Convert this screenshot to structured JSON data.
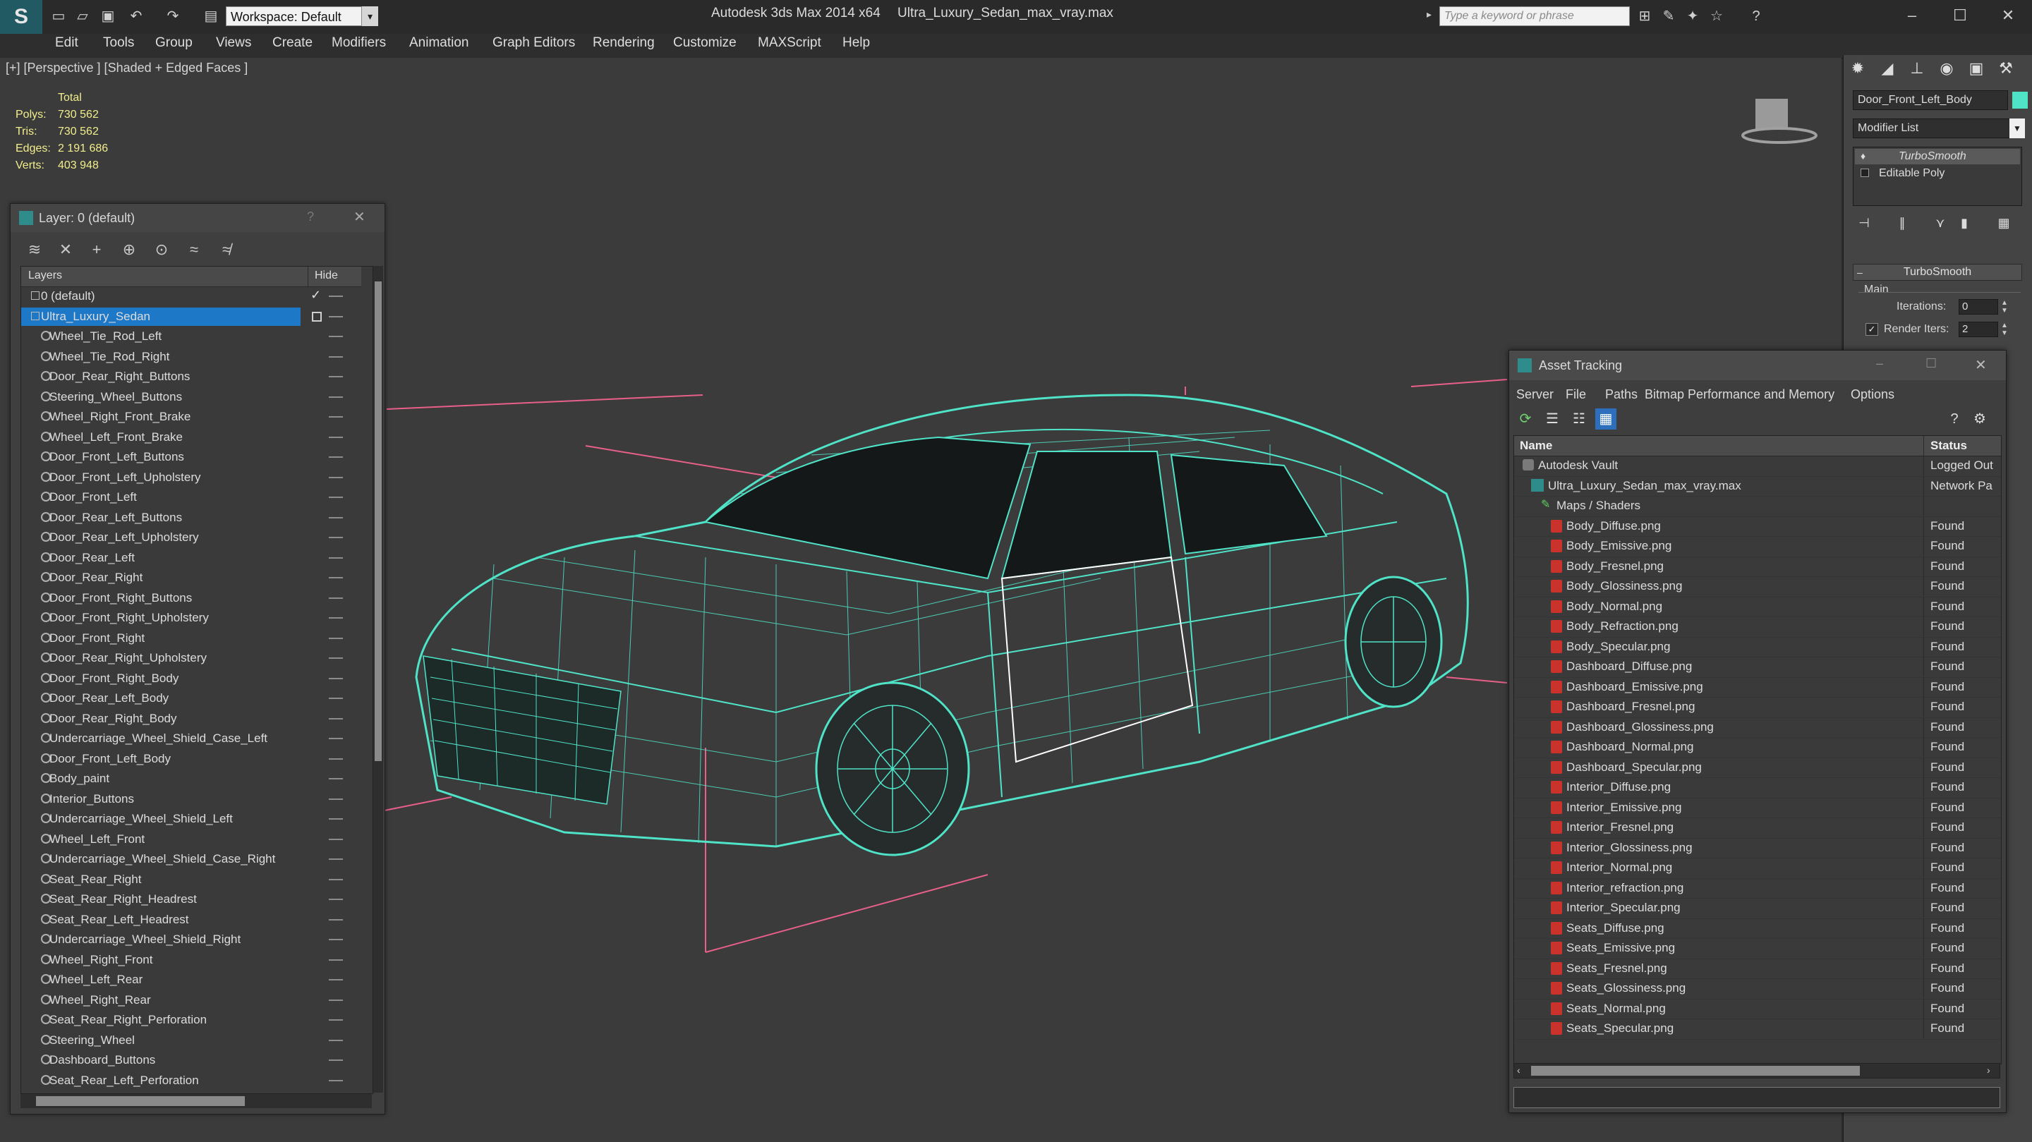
{
  "titlebar": {
    "workspace": "Workspace: Default",
    "app_title": "Autodesk 3ds Max  2014 x64",
    "file_title": "Ultra_Luxury_Sedan_max_vray.max",
    "search_placeholder": "Type a keyword or phrase"
  },
  "menu": [
    "Edit",
    "Tools",
    "Group",
    "Views",
    "Create",
    "Modifiers",
    "Animation",
    "Graph Editors",
    "Rendering",
    "Customize",
    "MAXScript",
    "Help"
  ],
  "viewport": {
    "label": "[+] [Perspective ] [Shaded + Edged Faces ]",
    "stats_header": "Total",
    "stats": [
      {
        "label": "Polys:",
        "value": "730 562"
      },
      {
        "label": "Tris:",
        "value": "730 562"
      },
      {
        "label": "Edges:",
        "value": "2 191 686"
      },
      {
        "label": "Verts:",
        "value": "403 948"
      }
    ],
    "wire_color": "#4fe3c8"
  },
  "layer_panel": {
    "title": "Layer: 0 (default)",
    "col_layers": "Layers",
    "col_hide": "Hide",
    "rows": [
      "0 (default)",
      "Ultra_Luxury_Sedan",
      "Wheel_Tie_Rod_Left",
      "Wheel_Tie_Rod_Right",
      "Door_Rear_Right_Buttons",
      "Steering_Wheel_Buttons",
      "Wheel_Right_Front_Brake",
      "Wheel_Left_Front_Brake",
      "Door_Front_Left_Buttons",
      "Door_Front_Left_Upholstery",
      "Door_Front_Left",
      "Door_Rear_Left_Buttons",
      "Door_Rear_Left_Upholstery",
      "Door_Rear_Left",
      "Door_Rear_Right",
      "Door_Front_Right_Buttons",
      "Door_Front_Right_Upholstery",
      "Door_Front_Right",
      "Door_Rear_Right_Upholstery",
      "Door_Front_Right_Body",
      "Door_Rear_Left_Body",
      "Door_Rear_Right_Body",
      "Undercarriage_Wheel_Shield_Case_Left",
      "Door_Front_Left_Body",
      "Body_paint",
      "Interior_Buttons",
      "Undercarriage_Wheel_Shield_Left",
      "Wheel_Left_Front",
      "Undercarriage_Wheel_Shield_Case_Right",
      "Seat_Rear_Right",
      "Seat_Rear_Right_Headrest",
      "Seat_Rear_Left_Headrest",
      "Undercarriage_Wheel_Shield_Right",
      "Wheel_Right_Front",
      "Wheel_Left_Rear",
      "Wheel_Right_Rear",
      "Seat_Rear_Right_Perforation",
      "Steering_Wheel",
      "Dashboard_Buttons",
      "Seat_Rear_Left_Perforation"
    ]
  },
  "command_panel": {
    "object_name": "Door_Front_Left_Body",
    "modifier_list": "Modifier List",
    "stack": [
      "TurboSmooth",
      "Editable Poly"
    ],
    "rollout": "TurboSmooth",
    "group": "Main",
    "iterations_label": "Iterations:",
    "iterations_value": "0",
    "render_iters_label": "Render Iters:",
    "render_iters_value": "2"
  },
  "asset_tracking": {
    "title": "Asset Tracking",
    "menu": [
      "Server",
      "File",
      "Paths",
      "Bitmap Performance and Memory",
      "Options"
    ],
    "col_name": "Name",
    "col_status": "Status",
    "rows": [
      {
        "name": "Autodesk Vault",
        "status": "Logged Out"
      },
      {
        "name": "Ultra_Luxury_Sedan_max_vray.max",
        "status": "Network Pa"
      },
      {
        "name": "Maps / Shaders",
        "status": ""
      },
      {
        "name": "Body_Diffuse.png",
        "status": "Found"
      },
      {
        "name": "Body_Emissive.png",
        "status": "Found"
      },
      {
        "name": "Body_Fresnel.png",
        "status": "Found"
      },
      {
        "name": "Body_Glossiness.png",
        "status": "Found"
      },
      {
        "name": "Body_Normal.png",
        "status": "Found"
      },
      {
        "name": "Body_Refraction.png",
        "status": "Found"
      },
      {
        "name": "Body_Specular.png",
        "status": "Found"
      },
      {
        "name": "Dashboard_Diffuse.png",
        "status": "Found"
      },
      {
        "name": "Dashboard_Emissive.png",
        "status": "Found"
      },
      {
        "name": "Dashboard_Fresnel.png",
        "status": "Found"
      },
      {
        "name": "Dashboard_Glossiness.png",
        "status": "Found"
      },
      {
        "name": "Dashboard_Normal.png",
        "status": "Found"
      },
      {
        "name": "Dashboard_Specular.png",
        "status": "Found"
      },
      {
        "name": "Interior_Diffuse.png",
        "status": "Found"
      },
      {
        "name": "Interior_Emissive.png",
        "status": "Found"
      },
      {
        "name": "Interior_Fresnel.png",
        "status": "Found"
      },
      {
        "name": "Interior_Glossiness.png",
        "status": "Found"
      },
      {
        "name": "Interior_Normal.png",
        "status": "Found"
      },
      {
        "name": "Interior_refraction.png",
        "status": "Found"
      },
      {
        "name": "Interior_Specular.png",
        "status": "Found"
      },
      {
        "name": "Seats_Diffuse.png",
        "status": "Found"
      },
      {
        "name": "Seats_Emissive.png",
        "status": "Found"
      },
      {
        "name": "Seats_Fresnel.png",
        "status": "Found"
      },
      {
        "name": "Seats_Glossiness.png",
        "status": "Found"
      },
      {
        "name": "Seats_Normal.png",
        "status": "Found"
      },
      {
        "name": "Seats_Specular.png",
        "status": "Found"
      }
    ]
  }
}
